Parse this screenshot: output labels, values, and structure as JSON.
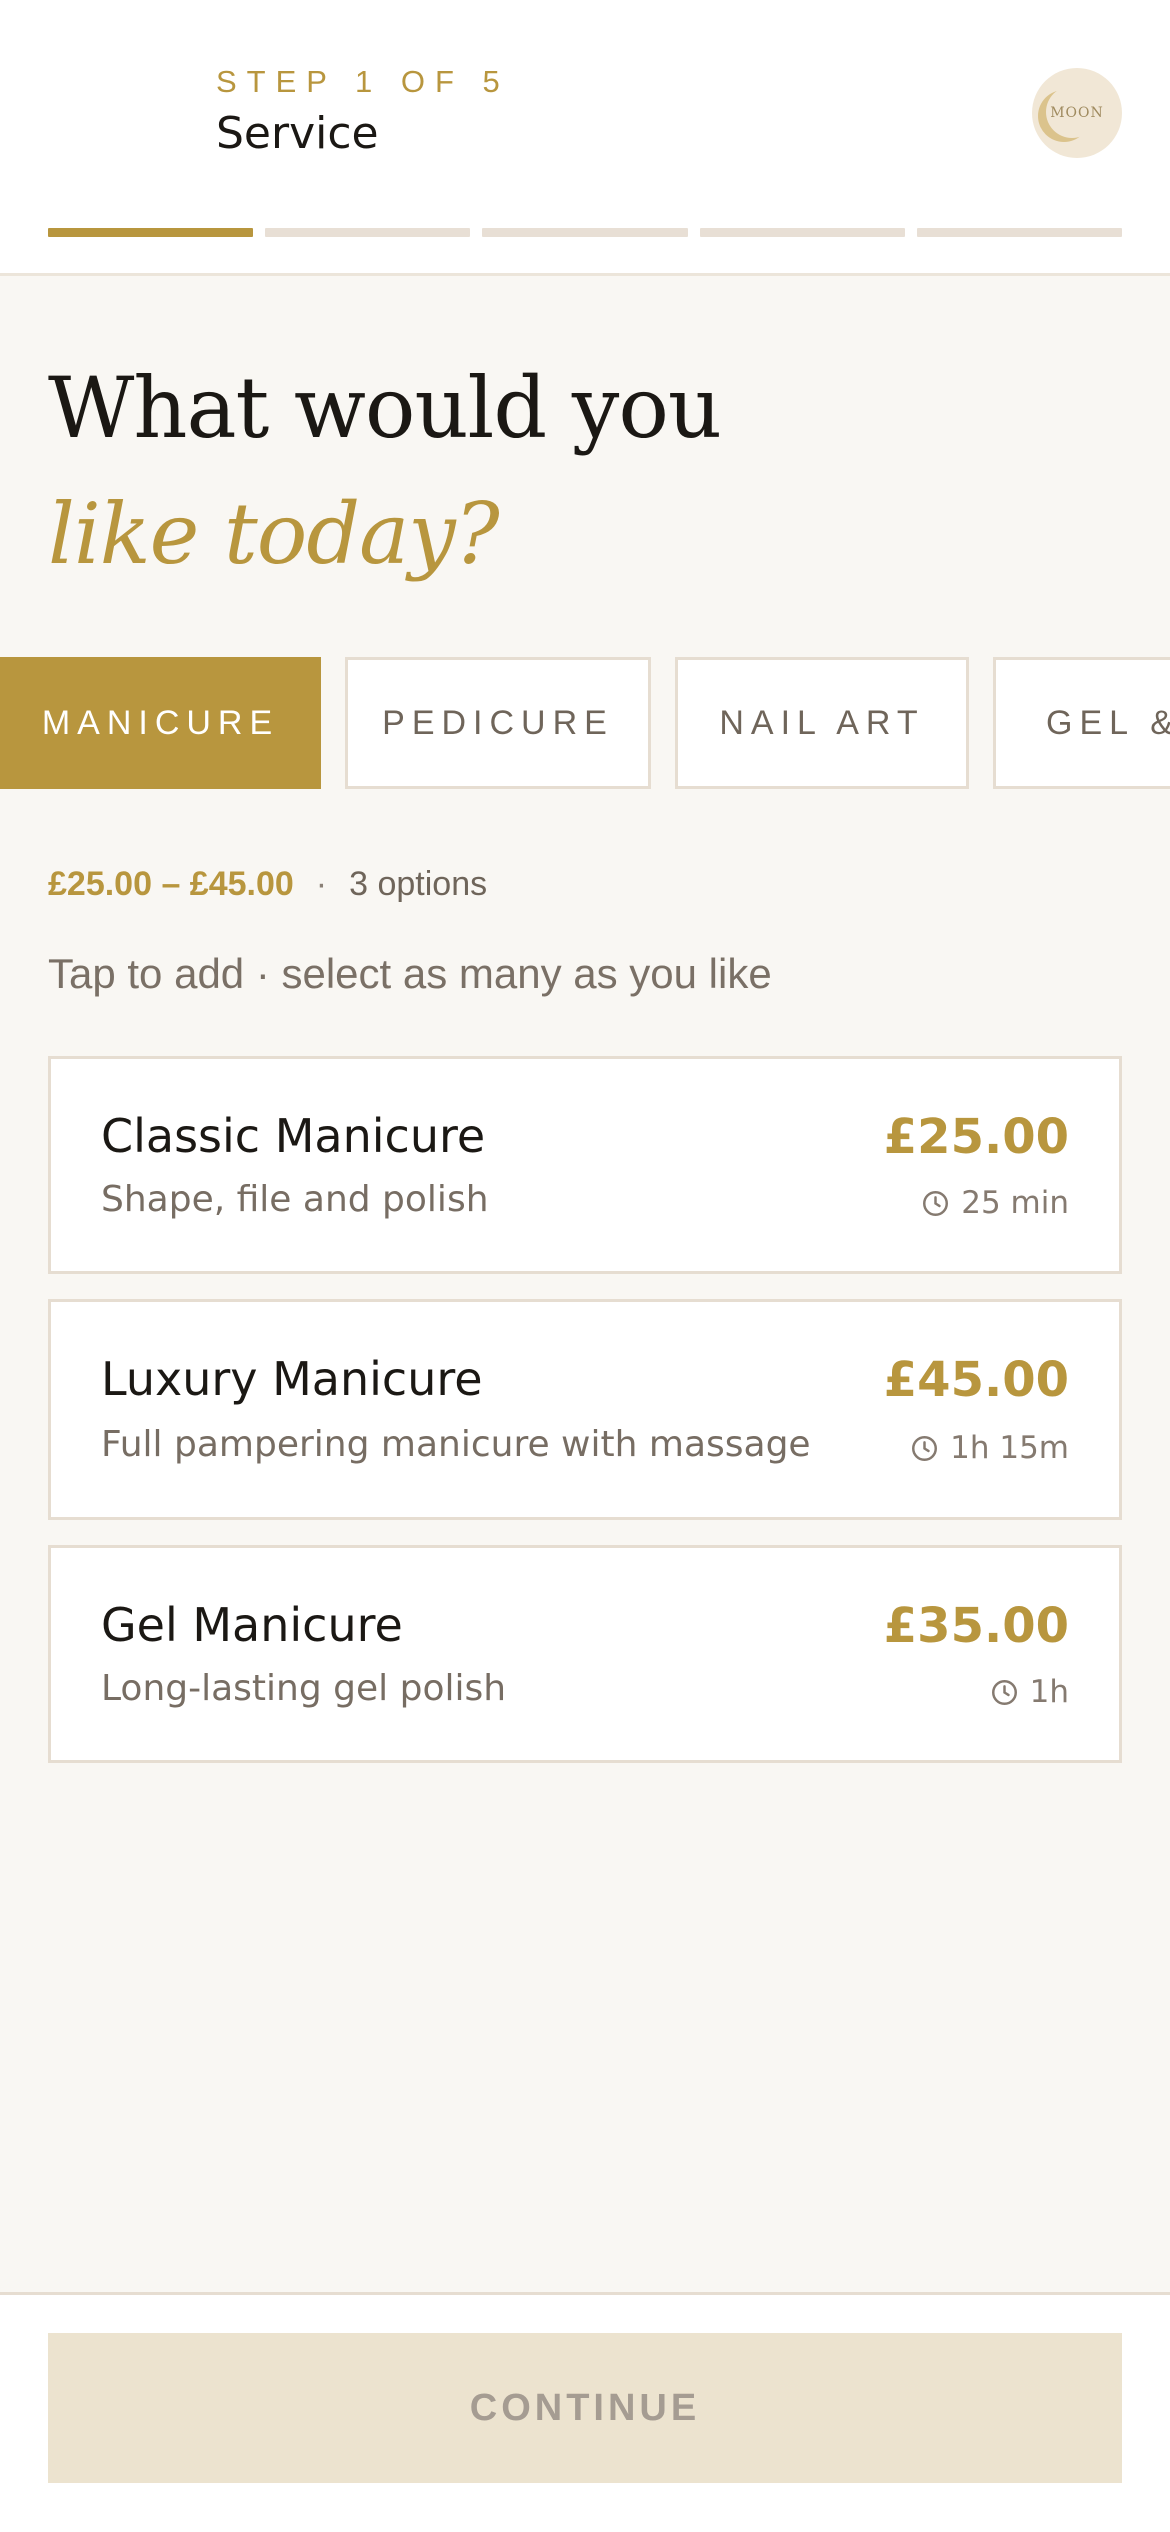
{
  "header": {
    "step_label": "STEP 1 OF 5",
    "step_title": "Service",
    "logo_text": "MOON",
    "progress": {
      "current_step": 1,
      "total_steps": 5
    }
  },
  "headline": {
    "line1": "What would you",
    "line2": "like today?"
  },
  "categories": [
    {
      "label": "MANICURE",
      "active": true
    },
    {
      "label": "PEDICURE",
      "active": false
    },
    {
      "label": "NAIL ART",
      "active": false
    },
    {
      "label": "GEL &",
      "active": false
    }
  ],
  "summary": {
    "price_range": "£25.00 – £45.00",
    "separator": "·",
    "options_count": "3 options"
  },
  "hint": "Tap to add · select as many as you like",
  "services": [
    {
      "name": "Classic Manicure",
      "description": "Shape, file and polish",
      "price": "£25.00",
      "duration": "25 min"
    },
    {
      "name": "Luxury Manicure",
      "description": "Full pampering manicure with massage",
      "price": "£45.00",
      "duration": "1h 15m"
    },
    {
      "name": "Gel Manicure",
      "description": "Long-lasting gel polish",
      "price": "£35.00",
      "duration": "1h"
    }
  ],
  "footer": {
    "continue_label": "CONTINUE"
  },
  "colors": {
    "accent": "#b8963e",
    "background": "#f9f7f3",
    "border": "#e6ddd1",
    "disabled_button": "#ece3cf"
  },
  "icons": {
    "duration": "clock-icon",
    "logo": "moon-logo-icon"
  }
}
